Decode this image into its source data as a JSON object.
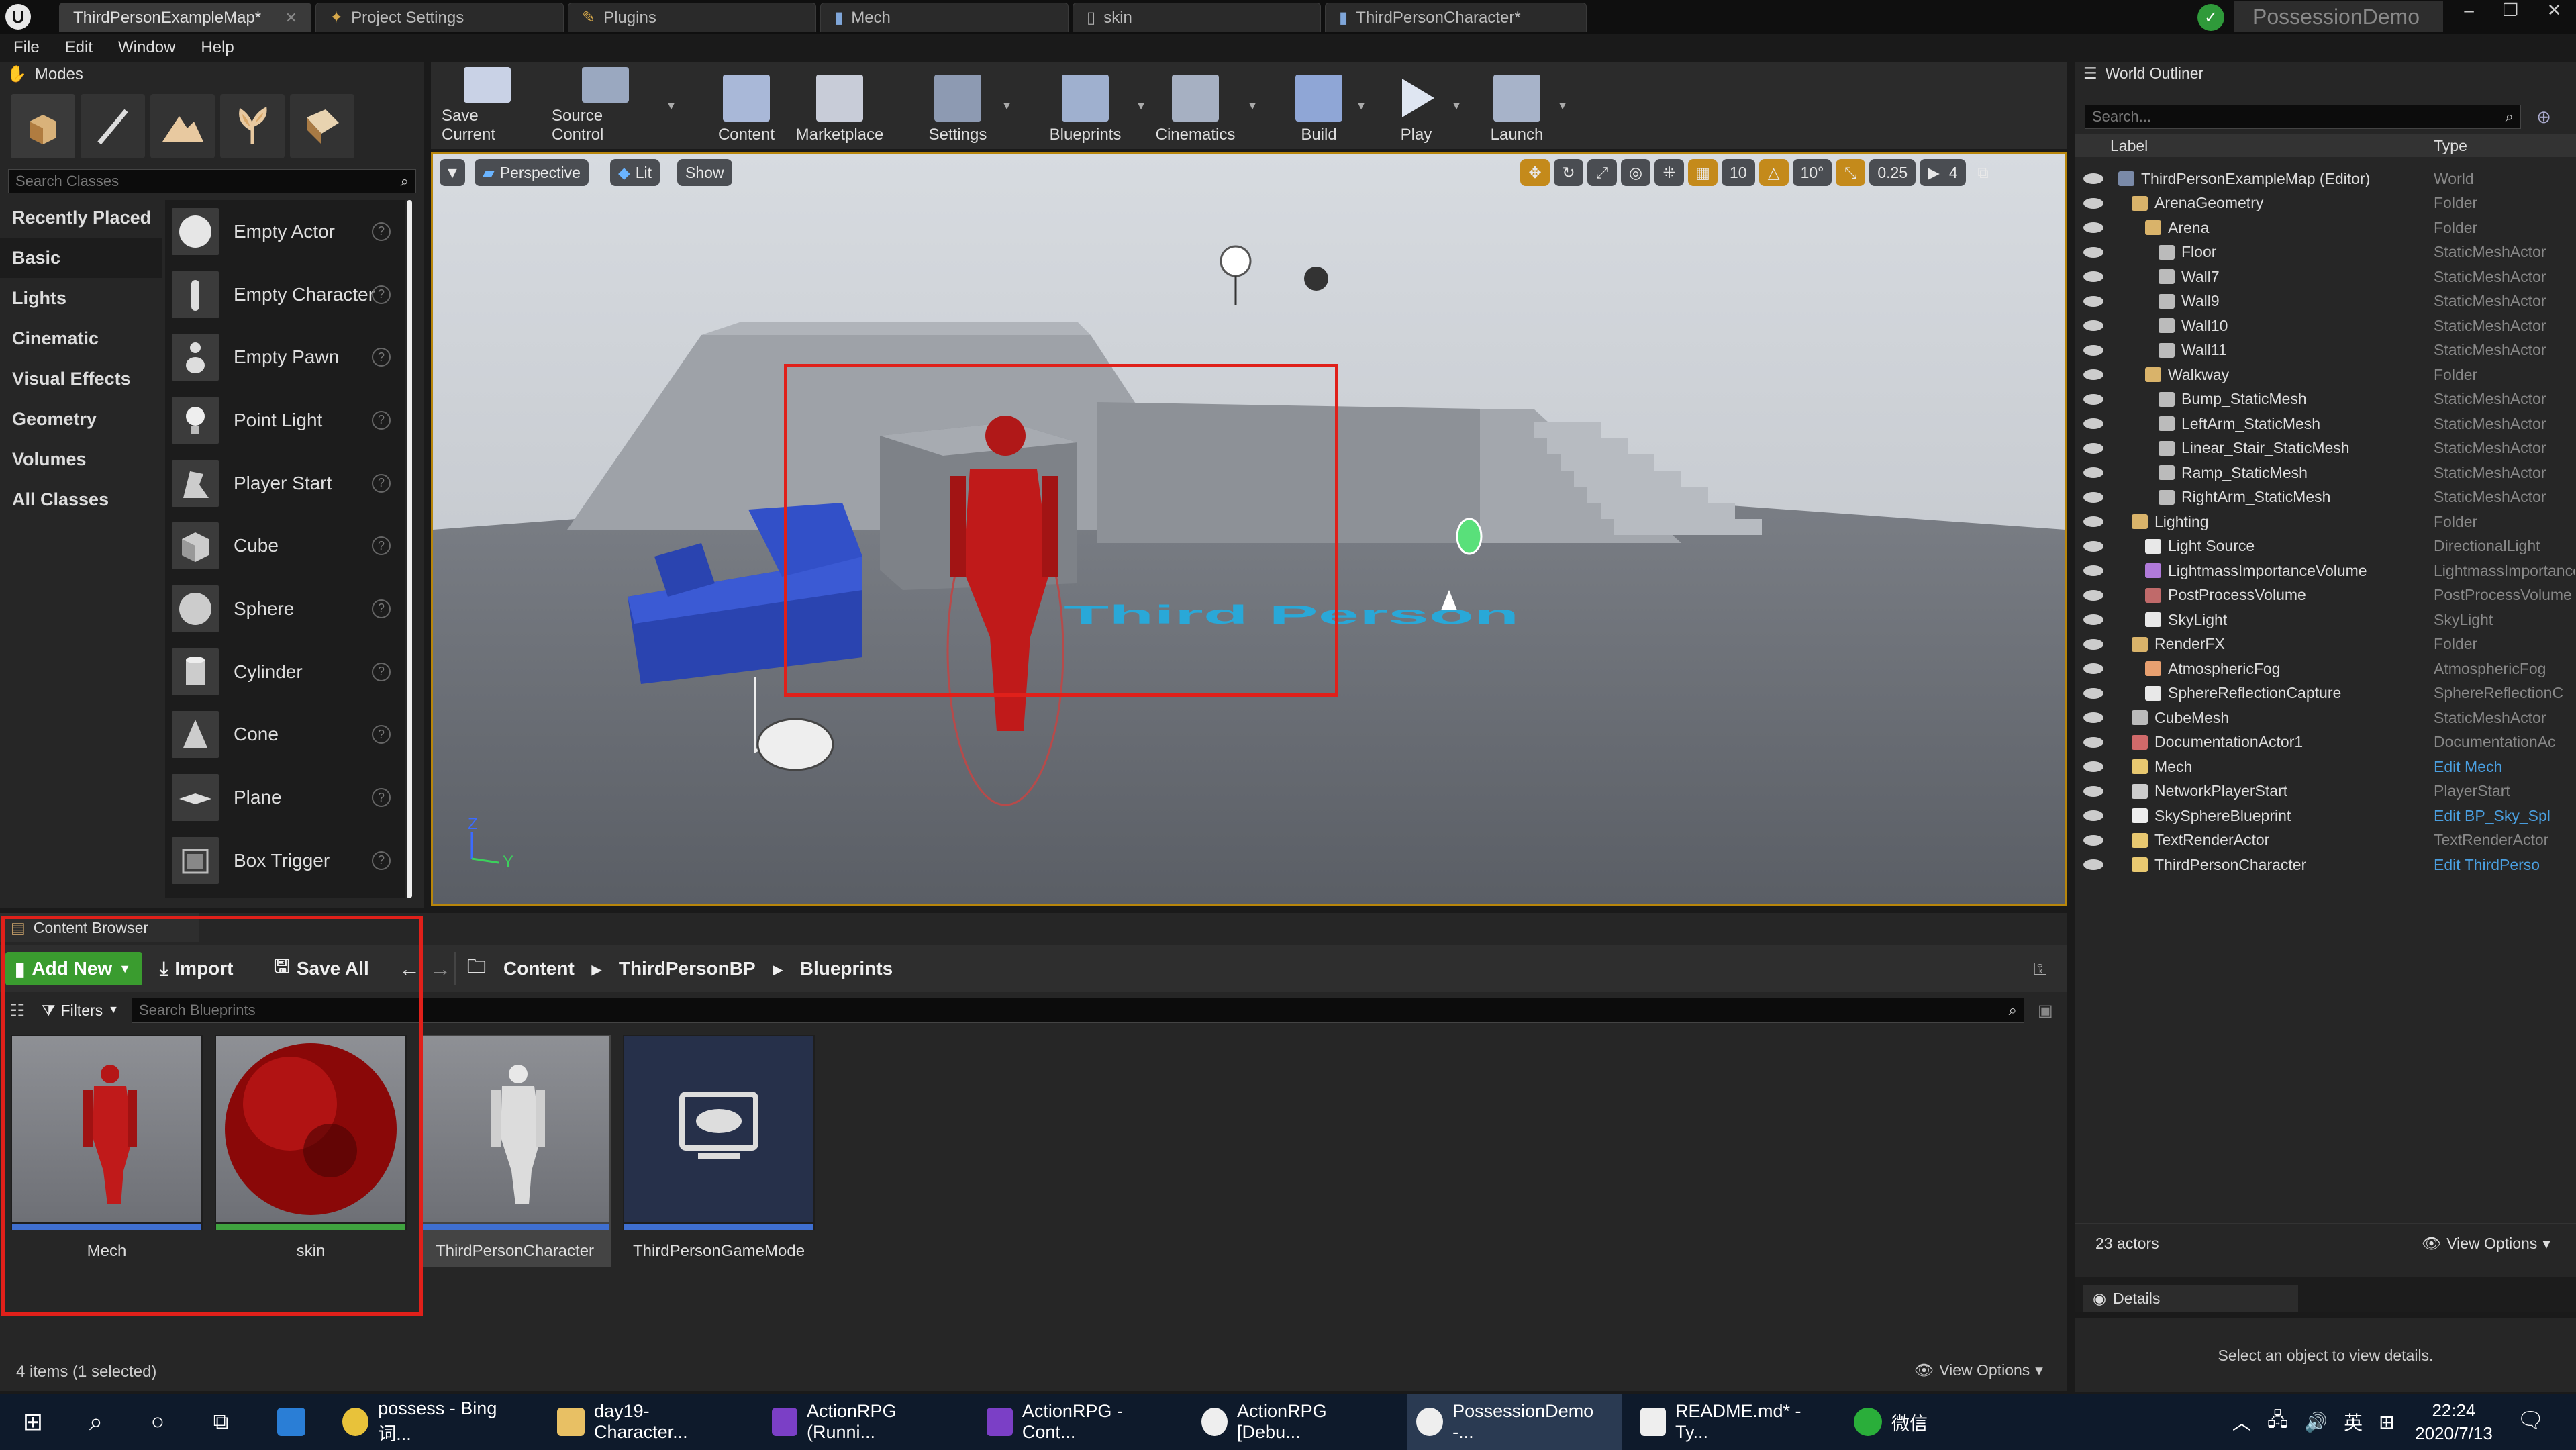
{
  "window": {
    "project_name": "PossessionDemo",
    "tabs": [
      {
        "label": "ThirdPersonExampleMap*"
      },
      {
        "label": "Project Settings"
      },
      {
        "label": "Plugins"
      },
      {
        "label": "Mech"
      },
      {
        "label": "skin"
      },
      {
        "label": "ThirdPersonCharacter*"
      }
    ]
  },
  "menu": [
    "File",
    "Edit",
    "Window",
    "Help"
  ],
  "modes": {
    "title": "Modes",
    "search_placeholder": "Search Classes",
    "categories": [
      "Recently Placed",
      "Basic",
      "Lights",
      "Cinematic",
      "Visual Effects",
      "Geometry",
      "Volumes",
      "All Classes"
    ],
    "selected_category": "Basic",
    "items": [
      "Empty Actor",
      "Empty Character",
      "Empty Pawn",
      "Point Light",
      "Player Start",
      "Cube",
      "Sphere",
      "Cylinder",
      "Cone",
      "Plane",
      "Box Trigger"
    ]
  },
  "toolbar": [
    "Save Current",
    "Source Control",
    "Content",
    "Marketplace",
    "Settings",
    "Blueprints",
    "Cinematics",
    "Build",
    "Play",
    "Launch"
  ],
  "viewport": {
    "perspective": "Perspective",
    "lit": "Lit",
    "show": "Show",
    "grid_snap": "10",
    "rotation_snap": "10°",
    "scale_snap": "0.25",
    "camera_speed": "4",
    "floor_text": "Third Person",
    "axis_z": "Z",
    "axis_y": "Y"
  },
  "outliner": {
    "title": "World Outliner",
    "search_placeholder": "Search...",
    "col_label": "Label",
    "col_type": "Type",
    "rows": [
      {
        "label": "ThirdPersonExampleMap (Editor)",
        "type": "World"
      },
      {
        "label": "ArenaGeometry",
        "type": "Folder"
      },
      {
        "label": "Arena",
        "type": "Folder"
      },
      {
        "label": "Floor",
        "type": "StaticMeshActor"
      },
      {
        "label": "Wall7",
        "type": "StaticMeshActor"
      },
      {
        "label": "Wall9",
        "type": "StaticMeshActor"
      },
      {
        "label": "Wall10",
        "type": "StaticMeshActor"
      },
      {
        "label": "Wall11",
        "type": "StaticMeshActor"
      },
      {
        "label": "Walkway",
        "type": "Folder"
      },
      {
        "label": "Bump_StaticMesh",
        "type": "StaticMeshActor"
      },
      {
        "label": "LeftArm_StaticMesh",
        "type": "StaticMeshActor"
      },
      {
        "label": "Linear_Stair_StaticMesh",
        "type": "StaticMeshActor"
      },
      {
        "label": "Ramp_StaticMesh",
        "type": "StaticMeshActor"
      },
      {
        "label": "RightArm_StaticMesh",
        "type": "StaticMeshActor"
      },
      {
        "label": "Lighting",
        "type": "Folder"
      },
      {
        "label": "Light Source",
        "type": "DirectionalLight"
      },
      {
        "label": "LightmassImportanceVolume",
        "type": "LightmassImportance"
      },
      {
        "label": "PostProcessVolume",
        "type": "PostProcessVolume"
      },
      {
        "label": "SkyLight",
        "type": "SkyLight"
      },
      {
        "label": "RenderFX",
        "type": "Folder"
      },
      {
        "label": "AtmosphericFog",
        "type": "AtmosphericFog"
      },
      {
        "label": "SphereReflectionCapture",
        "type": "SphereReflectionC"
      },
      {
        "label": "CubeMesh",
        "type": "StaticMeshActor"
      },
      {
        "label": "DocumentationActor1",
        "type": "DocumentationAc"
      },
      {
        "label": "Mech",
        "type": "Edit Mech"
      },
      {
        "label": "NetworkPlayerStart",
        "type": "PlayerStart"
      },
      {
        "label": "SkySphereBlueprint",
        "type": "Edit BP_Sky_Spl"
      },
      {
        "label": "TextRenderActor",
        "type": "TextRenderActor"
      },
      {
        "label": "ThirdPersonCharacter",
        "type": "Edit ThirdPerso"
      }
    ],
    "actor_count": "23 actors",
    "view_options": "View Options"
  },
  "details": {
    "title": "Details",
    "empty_message": "Select an object to view details."
  },
  "content_browser": {
    "title": "Content Browser",
    "add_new": "Add New",
    "import": "Import",
    "save_all": "Save All",
    "path": [
      "Content",
      "ThirdPersonBP",
      "Blueprints"
    ],
    "filters": "Filters",
    "search_placeholder": "Search Blueprints",
    "assets": [
      {
        "name": "Mech",
        "bar_color": "#3f6fd0"
      },
      {
        "name": "skin",
        "bar_color": "#3fa33f"
      },
      {
        "name": "ThirdPersonCharacter",
        "bar_color": "#3f6fd0"
      },
      {
        "name": "ThirdPersonGameMode",
        "bar_color": "#3f6fd0"
      }
    ],
    "status": "4 items (1 selected)",
    "view_options": "View Options"
  },
  "taskbar": {
    "items": [
      "possess - Bing 词...",
      "day19-Character...",
      "ActionRPG (Runni...",
      "ActionRPG - Cont...",
      "ActionRPG [Debu...",
      "PossessionDemo -...",
      "README.md* - Ty...",
      "微信"
    ],
    "ime": "英",
    "time": "22:24",
    "date": "2020/7/13"
  }
}
